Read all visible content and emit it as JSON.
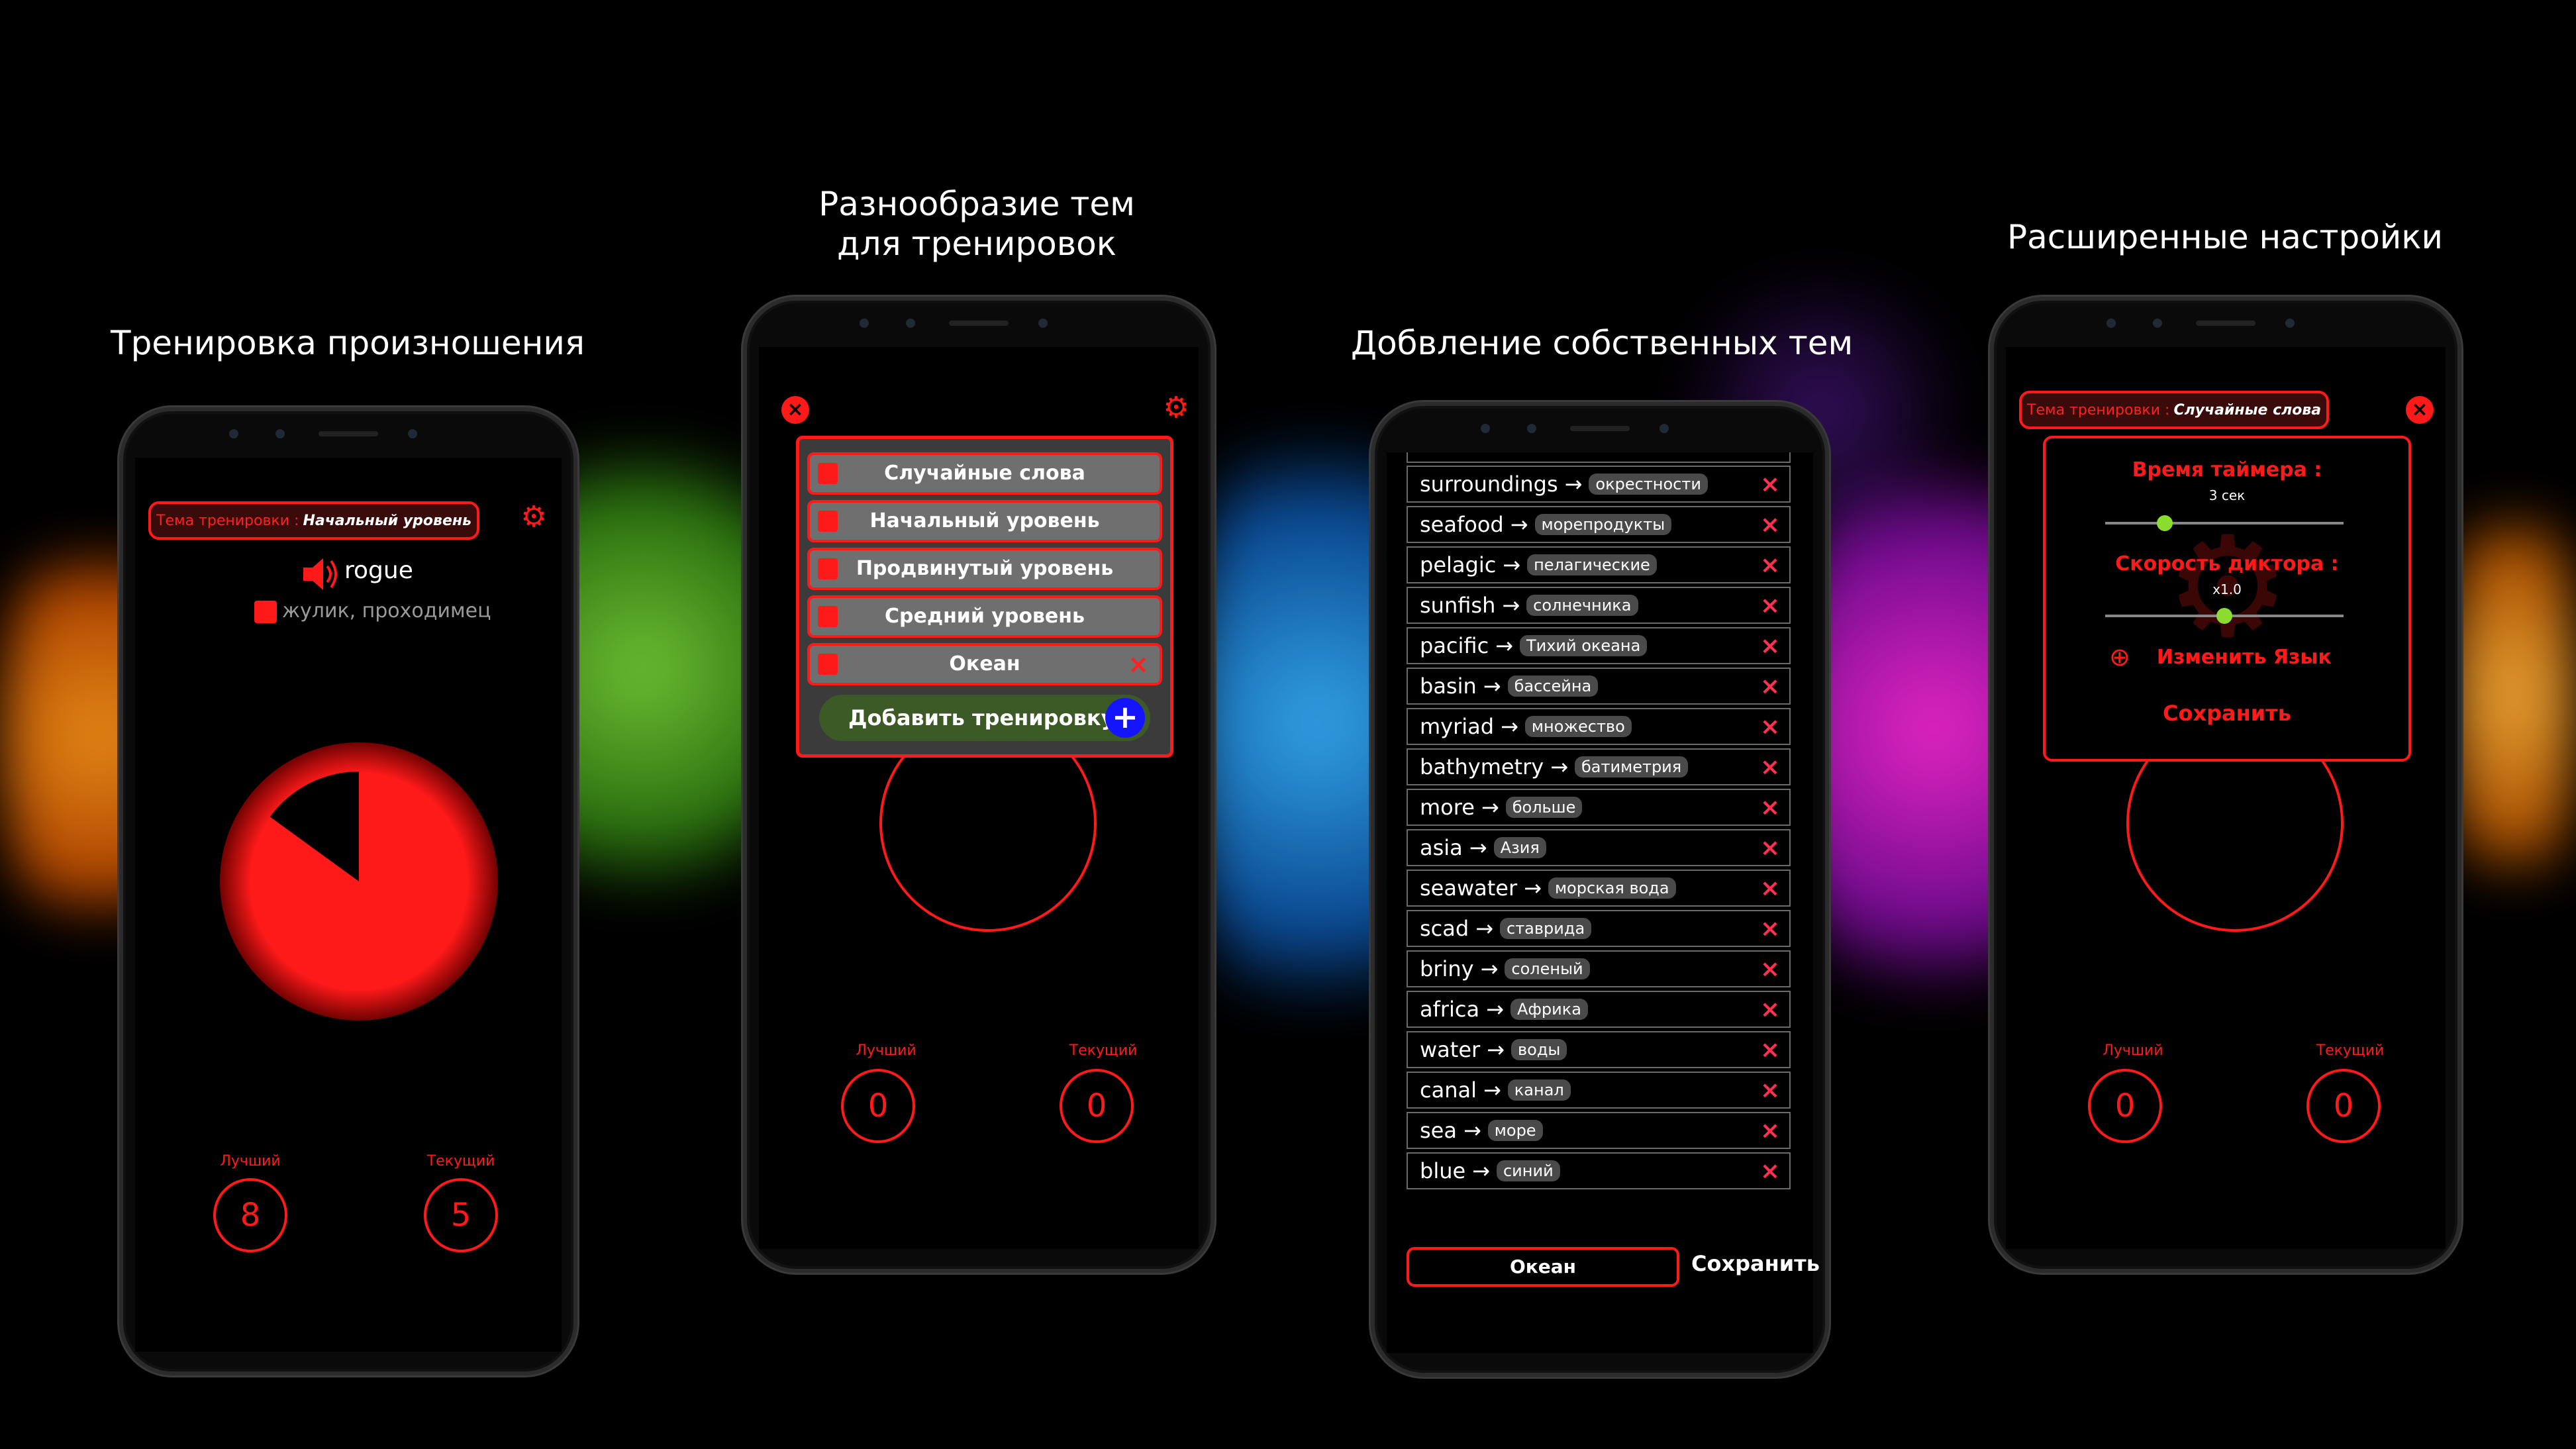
{
  "headlines": {
    "pronunciation": "Тренировка произношения",
    "themes_line1": "Разнообразие тем",
    "themes_line2": "для тренировок",
    "own_themes": "Добвление собственных тем",
    "settings": "Расширенные настройки"
  },
  "phone1": {
    "theme_prefix": "Тема тренировки :",
    "theme_value": "Начальный уровень",
    "word": "rogue",
    "translation": "жулик, проходимец",
    "best_label": "Лучший",
    "best_value": "8",
    "current_label": "Текущий",
    "current_value": "5",
    "timer_remaining_fraction": 0.85
  },
  "phone2": {
    "menu": [
      {
        "label": "Случайные слова",
        "deletable": false
      },
      {
        "label": "Начальный уровень",
        "deletable": false
      },
      {
        "label": "Продвинутый уровень",
        "deletable": false
      },
      {
        "label": "Средний уровень",
        "deletable": false
      },
      {
        "label": "Океан",
        "deletable": true
      }
    ],
    "add_label": "Добавить тренировку",
    "best_label": "Лучший",
    "best_value": "0",
    "current_label": "Текущий",
    "current_value": "0"
  },
  "phone3": {
    "words": [
      {
        "en": "surroundings",
        "ru": "окрестности"
      },
      {
        "en": "seafood",
        "ru": "морепродукты"
      },
      {
        "en": "pelagic",
        "ru": "пелагические"
      },
      {
        "en": "sunfish",
        "ru": "солнечника"
      },
      {
        "en": "pacific",
        "ru": "Тихий океана"
      },
      {
        "en": "basin",
        "ru": "бассейна"
      },
      {
        "en": "myriad",
        "ru": "множество"
      },
      {
        "en": "bathymetry",
        "ru": "батиметрия"
      },
      {
        "en": "more",
        "ru": "больше"
      },
      {
        "en": "asia",
        "ru": "Азия"
      },
      {
        "en": "seawater",
        "ru": "морская вода"
      },
      {
        "en": "scad",
        "ru": "ставрида"
      },
      {
        "en": "briny",
        "ru": "соленый"
      },
      {
        "en": "africa",
        "ru": "Африка"
      },
      {
        "en": "water",
        "ru": "воды"
      },
      {
        "en": "canal",
        "ru": "канал"
      },
      {
        "en": "sea",
        "ru": "море"
      },
      {
        "en": "blue",
        "ru": "синий"
      }
    ],
    "theme_name_value": "Океан",
    "save_label": "Сохранить"
  },
  "phone4": {
    "theme_prefix": "Тема тренировки :",
    "theme_value": "Случайные слова",
    "timer_label": "Время таймера :",
    "timer_value": "3 сек",
    "timer_fraction": 0.25,
    "speed_label": "Скорость диктора :",
    "speed_value": "x1.0",
    "speed_fraction": 0.5,
    "language_label": "Изменить Язык",
    "save_label": "Сохранить",
    "best_label": "Лучший",
    "best_value": "0",
    "current_label": "Текущий",
    "current_value": "0"
  },
  "colors": {
    "accent": "#ff1a1a",
    "background": "#000000",
    "add_button": "#3c5a25",
    "plus_button": "#1414ff"
  }
}
